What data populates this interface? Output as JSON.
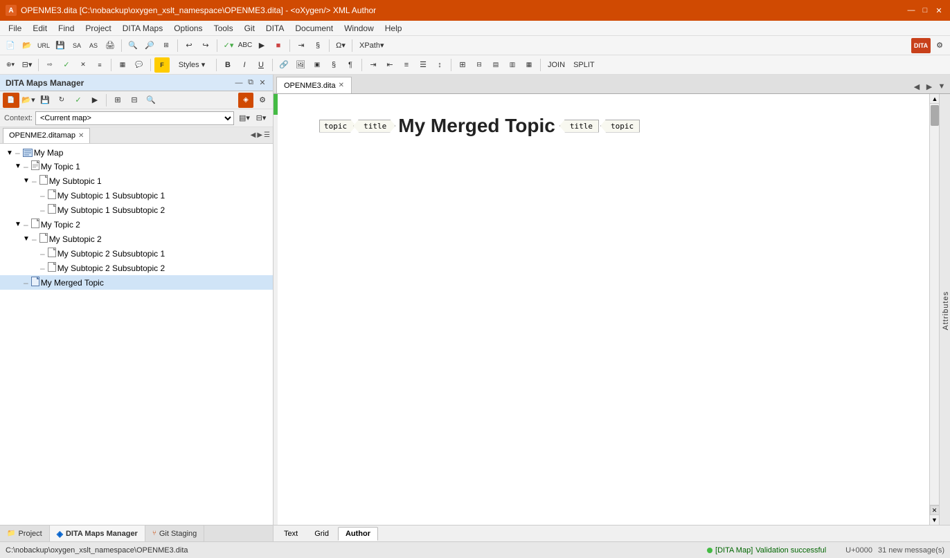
{
  "titleBar": {
    "icon": "A",
    "title": "OPENME3.dita [C:\\nobackup\\oxygen_xslt_namespace\\OPENME3.dita] - <oXygen/> XML Author",
    "controls": [
      "—",
      "□",
      "✕"
    ]
  },
  "menuBar": {
    "items": [
      "File",
      "Edit",
      "Find",
      "Project",
      "DITA Maps",
      "Options",
      "Tools",
      "Git",
      "DITA",
      "Document",
      "Window",
      "Help"
    ]
  },
  "leftPanel": {
    "title": "DITA Maps Manager",
    "contextLabel": "Context:",
    "contextValue": "<Current map>",
    "ditaTab": {
      "label": "OPENME2.ditamap",
      "close": "✕"
    },
    "tree": {
      "root": "My Map",
      "items": [
        {
          "id": "mymap",
          "label": "My Map",
          "level": 0,
          "type": "map",
          "expanded": true,
          "hasToggle": true
        },
        {
          "id": "mytopic1",
          "label": "My Topic 1",
          "level": 1,
          "type": "file",
          "expanded": true,
          "hasToggle": true
        },
        {
          "id": "mysubtopic1",
          "label": "My Subtopic 1",
          "level": 2,
          "type": "file",
          "expanded": true,
          "hasToggle": true
        },
        {
          "id": "mysubtopic1sub1",
          "label": "My Subtopic 1 Subsubtopic 1",
          "level": 3,
          "type": "file",
          "expanded": false,
          "hasToggle": false
        },
        {
          "id": "mysubtopic1sub2",
          "label": "My Subtopic 1 Subsubtopic 2",
          "level": 3,
          "type": "file",
          "expanded": false,
          "hasToggle": false
        },
        {
          "id": "mytopic2",
          "label": "My Topic 2",
          "level": 1,
          "type": "file",
          "expanded": true,
          "hasToggle": true
        },
        {
          "id": "mysubtopic2",
          "label": "My Subtopic 2",
          "level": 2,
          "type": "file",
          "expanded": true,
          "hasToggle": true
        },
        {
          "id": "mysubtopic2sub1",
          "label": "My Subtopic 2 Subsubtopic 1",
          "level": 3,
          "type": "file",
          "expanded": false,
          "hasToggle": false
        },
        {
          "id": "mysubtopic2sub2",
          "label": "My Subtopic 2 Subsubtopic 2",
          "level": 3,
          "type": "file",
          "expanded": false,
          "hasToggle": false
        },
        {
          "id": "mymergedtopic",
          "label": "My Merged Topic",
          "level": 1,
          "type": "file-selected",
          "expanded": false,
          "hasToggle": false
        }
      ]
    }
  },
  "editorTabBar": {
    "tabs": [
      {
        "label": "OPENME3.dita",
        "active": true,
        "close": "✕"
      }
    ],
    "navButtons": [
      "◀",
      "▶",
      "▼"
    ]
  },
  "editorContent": {
    "tags": {
      "topicOpen": "topic",
      "titleOpen": "title",
      "titleText": "My Merged Topic",
      "titleClose": "title",
      "topicClose": "topic"
    }
  },
  "bottomTabs": {
    "tabs": [
      {
        "label": "Text",
        "active": false
      },
      {
        "label": "Grid",
        "active": false
      },
      {
        "label": "Author",
        "active": true
      }
    ]
  },
  "attributesPanel": {
    "label": "Attributes"
  },
  "panelTabsBar": {
    "tabs": [
      {
        "label": "Project",
        "icon": "📁",
        "active": false
      },
      {
        "label": "DITA Maps Manager",
        "icon": "◈",
        "active": true
      },
      {
        "label": "Git Staging",
        "icon": "⑂",
        "active": false
      }
    ]
  },
  "statusBar": {
    "path": "C:\\nobackup\\oxygen_xslt_namespace\\OPENME3.dita",
    "validation": "Validation successful",
    "unicode": "U+0000",
    "messages": "31 new message(s)",
    "mapLabel": "[DITA Map]"
  }
}
